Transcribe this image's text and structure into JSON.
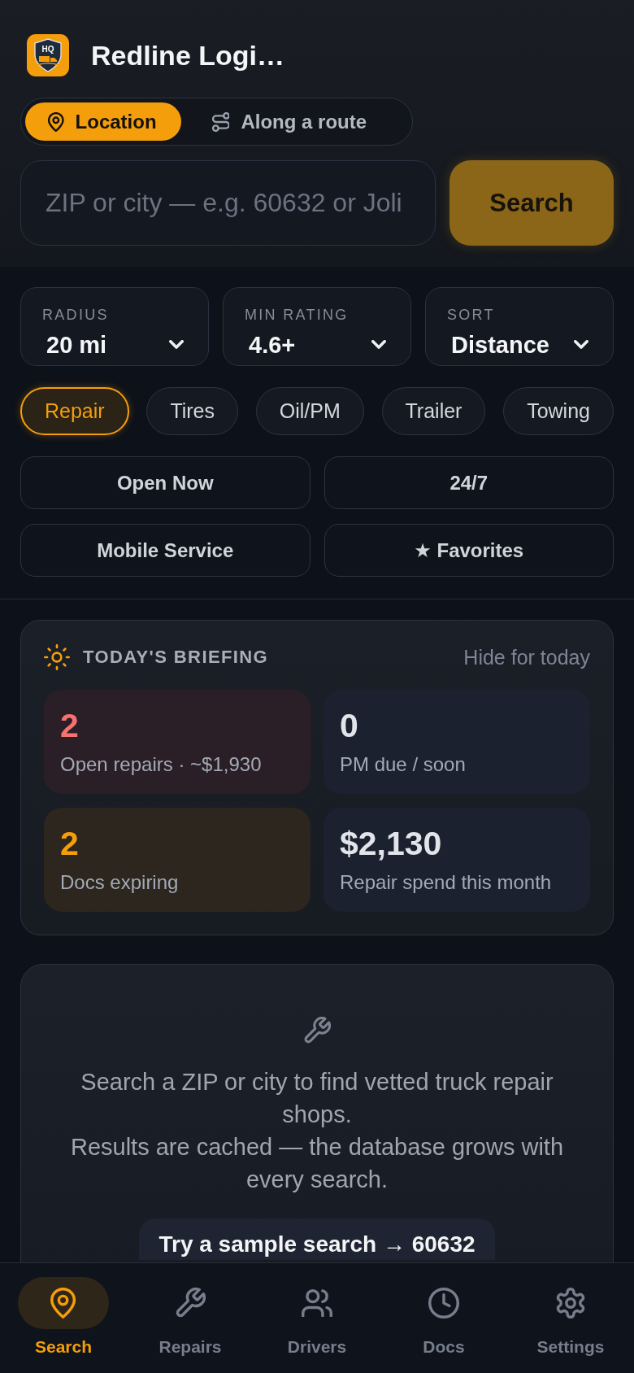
{
  "header": {
    "logo": {
      "text": "HQ"
    },
    "title": "Redline Logi…"
  },
  "search_mode": [
    {
      "label": "Location",
      "selected": true
    },
    {
      "label": "Along a route",
      "selected": false
    }
  ],
  "search": {
    "placeholder": "ZIP or city — e.g. 60632 or Joli",
    "button": {
      "label": "Search",
      "disabled": true
    }
  },
  "selects": [
    {
      "label": "RADIUS",
      "value": "20 mi"
    },
    {
      "label": "MIN RATING",
      "value": "4.6+"
    },
    {
      "label": "SORT",
      "value": "Distance"
    }
  ],
  "categories": [
    {
      "label": "Repair",
      "selected": true
    },
    {
      "label": "Tires",
      "selected": false
    },
    {
      "label": "Oil/PM",
      "selected": false
    },
    {
      "label": "Trailer",
      "selected": false
    },
    {
      "label": "Towing",
      "selected": false
    }
  ],
  "filters": [
    {
      "label": "Open Now",
      "on": false
    },
    {
      "label": "24/7",
      "on": false
    },
    {
      "label": "Mobile Service",
      "on": false
    },
    {
      "label": "★ Favorites",
      "on": false
    }
  ],
  "briefing": {
    "title": "TODAY'S BRIEFING",
    "action": "Hide for today",
    "tiles": [
      {
        "value": "2",
        "label": "Open repairs · ~$1,930",
        "kind": "alert"
      },
      {
        "value": "0",
        "label": "PM due / soon",
        "kind": "plain"
      },
      {
        "value": "2",
        "label": "Docs expiring",
        "kind": "warning"
      },
      {
        "value": "$2,130",
        "label": "Repair spend this month",
        "kind": "plain"
      }
    ]
  },
  "empty_state": {
    "lines": [
      "Search a ZIP or city to find vetted truck repair shops.",
      "Results are cached — the database grows with every search."
    ],
    "button": "Try a sample search → 60632"
  },
  "nav": [
    {
      "label": "Search",
      "selected": true
    },
    {
      "label": "Repairs",
      "selected": false
    },
    {
      "label": "Drivers",
      "selected": false
    },
    {
      "label": "Docs",
      "selected": false
    },
    {
      "label": "Settings",
      "selected": false
    }
  ]
}
